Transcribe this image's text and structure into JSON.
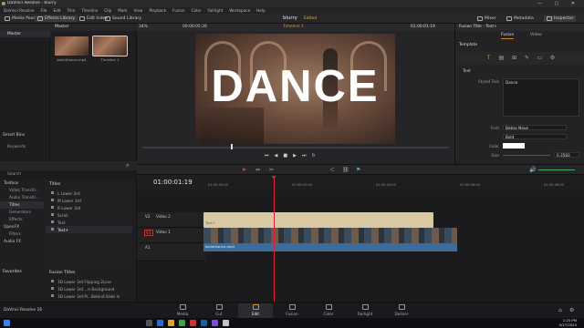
{
  "titlebar": {
    "app_title": "DaVinci Resolve - blurry",
    "window_buttons": "— ▢ ✕"
  },
  "menubar": [
    "DaVinci Resolve",
    "File",
    "Edit",
    "Trim",
    "Timeline",
    "Clip",
    "Mark",
    "View",
    "Playback",
    "Fusion",
    "Color",
    "Fairlight",
    "Workspace",
    "Help"
  ],
  "toolbar": {
    "media_pool": "Media Pool",
    "effects_library": "Effects Library",
    "edit_index": "Edit Index",
    "sound_library": "Sound Library",
    "project_name": "blurry",
    "project_status": "Edited",
    "mixer": "Mixer",
    "metadata": "Metadata",
    "inspector": "Inspector"
  },
  "mediapool": {
    "bin_label": "Master",
    "header_label": "Master",
    "clips": [
      {
        "name": "bailet5ance.mp4",
        "selected": false
      },
      {
        "name": "Timeline 1",
        "selected": true
      }
    ],
    "smart_bins": "Smart Bins",
    "keywords": "Keywords"
  },
  "viewer": {
    "zoom": "34%",
    "timecode_left": "00:00:05:26",
    "timeline_name": "Timeline 1",
    "timecode_right": "01:00:01:19",
    "title_text": "DANCE",
    "playhead_fraction": 0.29
  },
  "effects": {
    "search_label": "Search",
    "tree": [
      {
        "label": "Toolbox",
        "type": "head"
      },
      {
        "label": "Video Transiti...",
        "type": "item"
      },
      {
        "label": "Audio Transiti...",
        "type": "item"
      },
      {
        "label": "Titles",
        "type": "sel"
      },
      {
        "label": "Generators",
        "type": "item"
      },
      {
        "label": "Effects",
        "type": "item"
      },
      {
        "label": "OpenFX",
        "type": "head"
      },
      {
        "label": "Filters",
        "type": "item"
      },
      {
        "label": "Audio FX",
        "type": "head"
      }
    ],
    "favorites": "Favorites",
    "titles_heading": "Titles",
    "titles": [
      "L Lower 3rd",
      "M Lower 3rd",
      "R Lower 3rd",
      "Scroll",
      "Text",
      "Text+"
    ],
    "selected_title": "Text+",
    "fusion_heading": "Fusion Titles",
    "fusion_titles": [
      "3D Lower 3rd Flipping 2Line",
      "3D Lower 3rd ...e Background",
      "3D Lower 3rd Pi...Behind Slide In",
      "3D Lower 3rd Plane Slide In"
    ]
  },
  "inspector": {
    "panel_title": "Fusion Title - Text+",
    "tabs": [
      "Fusion",
      "Video"
    ],
    "active_tab": "Fusion",
    "template_label": "Template",
    "text_section": "Text",
    "styled_text_label": "Styled Text",
    "styled_text_value": "Dance",
    "font_label": "Font",
    "font_value": "Bebas Neue",
    "style_value": "Bold",
    "color_label": "Color",
    "size_label": "Size",
    "size_value": "0.3583"
  },
  "timeline": {
    "timecode": "01:00:01:19",
    "ruler_ticks": [
      "01:00:00:00",
      "01:00:02:00",
      "01:00:04:00",
      "01:00:06:00",
      "01:00:08:00"
    ],
    "tracks": [
      {
        "id": "V2",
        "name": "Video 2"
      },
      {
        "id": "V1",
        "name": "Video 1"
      },
      {
        "id": "A1",
        "name": ""
      }
    ],
    "title_clip_label": "Text+",
    "video_clip_label": "bailet5ance.mp4",
    "playhead_fraction": 0.18
  },
  "pages": [
    "Media",
    "Cut",
    "Edit",
    "Fusion",
    "Color",
    "Fairlight",
    "Deliver"
  ],
  "active_page": "Edit",
  "footer_app": "DaVinci Resolve 16",
  "clock": {
    "time": "1:25 PM",
    "date": "9/27/2020"
  },
  "colors": {
    "accent": "#e28a2e",
    "playhead": "#d22233",
    "title_clip": "#d8c9a3",
    "audio_clip": "#3a6d9c"
  }
}
